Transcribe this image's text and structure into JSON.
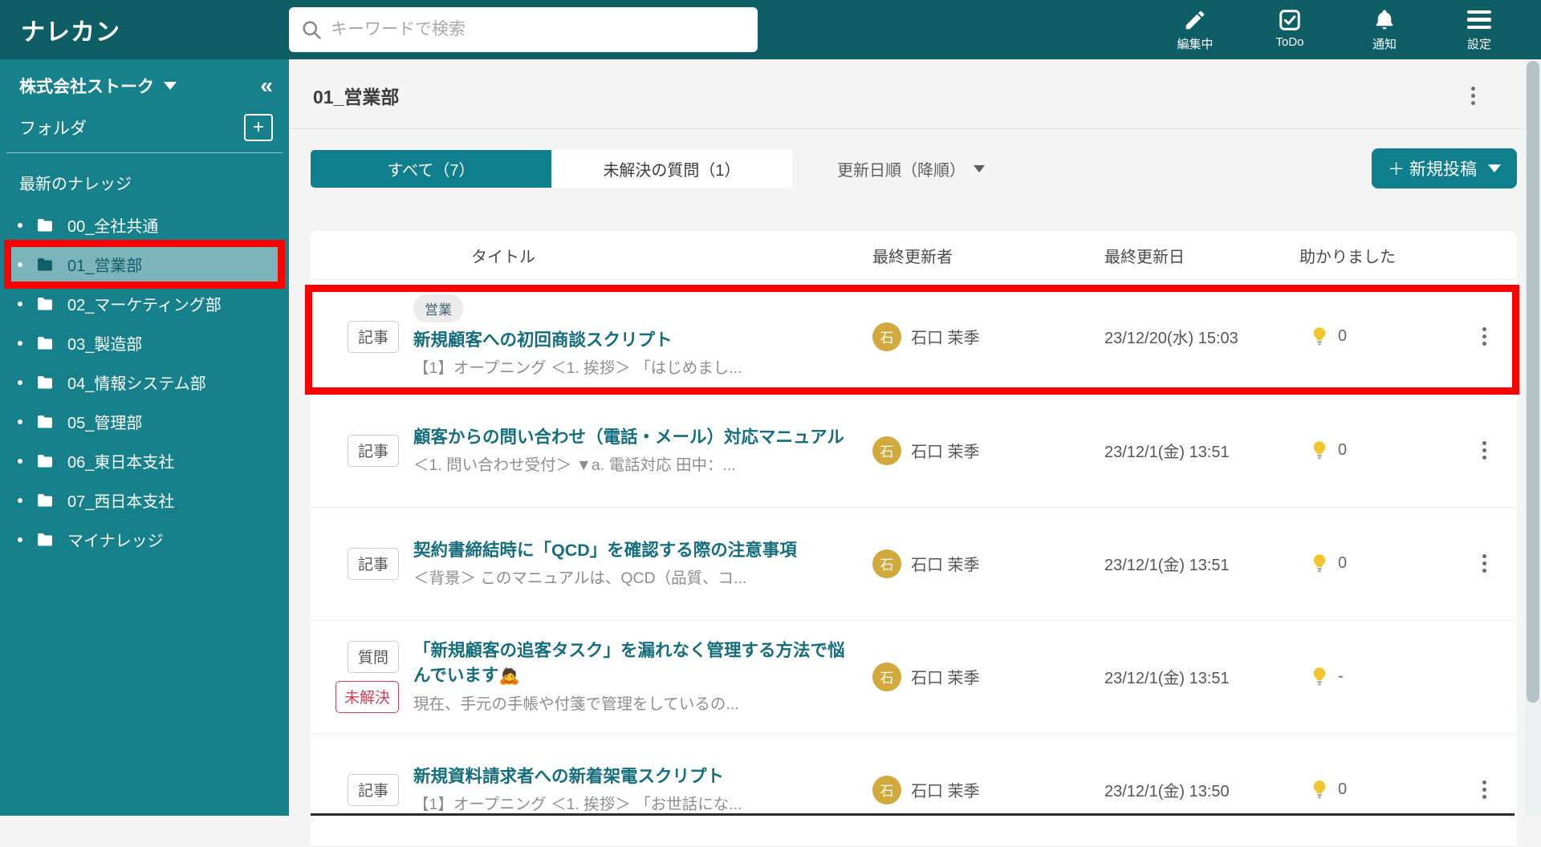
{
  "app": {
    "logo": "ナレカン"
  },
  "colors": {
    "topbar": "#0f5e66",
    "sidebar": "#17818b",
    "accent_teal": "#0f7f8d",
    "selected_folder_bg": "#7db3ba",
    "annotation_red": "#f80400",
    "avatar_gold": "#d2a93c",
    "title_link": "#156e7c",
    "unresolved_red": "#d04255"
  },
  "topbar": {
    "search_placeholder": "キーワードで検索",
    "actions": [
      {
        "icon": "pencil-icon",
        "label": "編集中"
      },
      {
        "icon": "todo-check-icon",
        "label": "ToDo"
      },
      {
        "icon": "bell-icon",
        "label": "通知"
      },
      {
        "icon": "menu-icon",
        "label": "設定"
      }
    ]
  },
  "sidebar": {
    "company": "株式会社ストーク",
    "collapse_glyph": "«",
    "folder_section_label": "フォルダ",
    "add_folder_glyph": "+",
    "latest_label": "最新のナレッジ",
    "items": [
      {
        "label": "00_全社共通",
        "selected": false,
        "annotated": false
      },
      {
        "label": "01_営業部",
        "selected": true,
        "annotated": true
      },
      {
        "label": "02_マーケティング部",
        "selected": false,
        "annotated": false
      },
      {
        "label": "03_製造部",
        "selected": false,
        "annotated": false
      },
      {
        "label": "04_情報システム部",
        "selected": false,
        "annotated": false
      },
      {
        "label": "05_管理部",
        "selected": false,
        "annotated": false
      },
      {
        "label": "06_東日本支社",
        "selected": false,
        "annotated": false
      },
      {
        "label": "07_西日本支社",
        "selected": false,
        "annotated": false
      },
      {
        "label": "マイナレッジ",
        "selected": false,
        "annotated": false
      }
    ]
  },
  "main": {
    "title": "01_営業部",
    "tabs": [
      {
        "label": "すべて（7）",
        "selected": true
      },
      {
        "label": "未解決の質問（1）",
        "selected": false
      }
    ],
    "sort_label": "更新日順（降順）",
    "new_post_label": "＋ 新規投稿",
    "table": {
      "headers": [
        "タイトル",
        "最終更新者",
        "最終更新日",
        "助かりました"
      ],
      "rows": [
        {
          "badge": "記事",
          "badge2": "",
          "tag": "営業",
          "title": "新規顧客への初回商談スクリプト",
          "snippet": "【1】オープニング ＜1. 挨拶＞ 「はじめまし...",
          "avatar_initial": "石",
          "updater": "石口 茉季",
          "date": "23/12/20(水) 15:03",
          "helped": "0",
          "annotated": true,
          "has_menu": true
        },
        {
          "badge": "記事",
          "badge2": "",
          "tag": "",
          "title": "顧客からの問い合わせ（電話・メール）対応マニュアル",
          "snippet": "＜1. 問い合わせ受付＞ ▼a. 電話対応 田中：...",
          "avatar_initial": "石",
          "updater": "石口 茉季",
          "date": "23/12/1(金) 13:51",
          "helped": "0",
          "annotated": false,
          "has_menu": true
        },
        {
          "badge": "記事",
          "badge2": "",
          "tag": "",
          "title": "契約書締結時に「QCD」を確認する際の注意事項",
          "snippet": "＜背景＞ このマニュアルは、QCD（品質、コ...",
          "avatar_initial": "石",
          "updater": "石口 茉季",
          "date": "23/12/1(金) 13:51",
          "helped": "0",
          "annotated": false,
          "has_menu": true
        },
        {
          "badge": "質問",
          "badge2": "未解決",
          "tag": "",
          "title": "「新規顧客の追客タスク」を漏れなく管理する方法で悩んでいます🙇",
          "snippet": "現在、手元の手帳や付箋で管理をしているの...",
          "avatar_initial": "石",
          "updater": "石口 茉季",
          "date": "23/12/1(金) 13:51",
          "helped": "-",
          "annotated": false,
          "has_menu": false
        },
        {
          "badge": "記事",
          "badge2": "",
          "tag": "",
          "title": "新規資料請求者への新着架電スクリプト",
          "snippet": "【1】オープニング ＜1. 挨拶＞ 「お世話にな...",
          "avatar_initial": "石",
          "updater": "石口 茉季",
          "date": "23/12/1(金) 13:50",
          "helped": "0",
          "annotated": false,
          "has_menu": true
        }
      ]
    }
  }
}
